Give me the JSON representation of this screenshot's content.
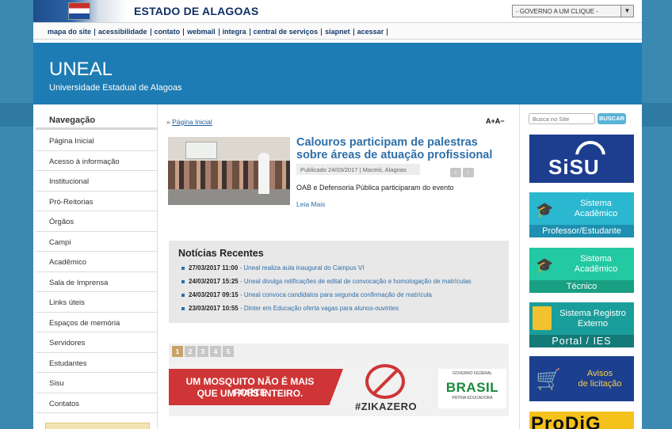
{
  "gov": {
    "title": "ESTADO DE ALAGOAS",
    "dropdown_selected": "- GOVERNO A UM CLIQUE -"
  },
  "toplinks": [
    "mapa do site",
    "acessibilidade",
    "contato",
    "webmail",
    "integra",
    "central de serviços",
    "siapnet",
    "acessar"
  ],
  "header": {
    "name": "UNEAL",
    "subtitle": "Universidade Estadual de Alagoas"
  },
  "nav": {
    "title": "Navegação",
    "items": [
      "Página Inicial",
      "Acesso à informação",
      "Institucional",
      "Pró-Reitorias",
      "Órgãos",
      "Campi",
      "Acadêmico",
      "Sala de Imprensa",
      "Links úteis",
      "Espaços de memória",
      "Servidores",
      "Estudantes",
      "Sisu",
      "Contatos"
    ]
  },
  "breadcrumb": {
    "prefix": "»",
    "current": "Página Inicial"
  },
  "font_size_control": "A+A−",
  "featured": {
    "headline": "Calouros participam de palestras sobre áreas de atuação profissional",
    "meta": "Publicado 24/03/2017 | Maceió, Alagoas",
    "summary": "OAB e Defensoria Pública participaram do evento",
    "more": "Leia Mais",
    "prev": "‹",
    "next": "›"
  },
  "recent": {
    "title": "Notícias Recentes",
    "items": [
      {
        "date": "27/03/2017 11:00",
        "text": "Uneal realiza aula inaugural do Campus VI"
      },
      {
        "date": "24/03/2017 15:25",
        "text": "Uneal divulga retificações de edital de convocação e homologação de matrículas"
      },
      {
        "date": "24/03/2017 09:15",
        "text": "Uneal convoca candidatos para segunda confirmação de matrícula"
      },
      {
        "date": "23/03/2017 10:55",
        "text": "Dinter em Educação oferta vagas para alunos-ouvintes"
      }
    ]
  },
  "pager": [
    "1",
    "2",
    "3",
    "4",
    "5"
  ],
  "banner_zika": {
    "line1": "UM MOSQUITO NÃO É MAIS FORTE",
    "line2": "QUE UM PAÍS INTEIRO.",
    "hashtag": "#ZIKAZERO",
    "gov_label": "GOVERNO FEDERAL",
    "brasil": "BRASIL",
    "patria": "PÁTRIA EDUCADORA"
  },
  "search": {
    "placeholder": "Busca no Site",
    "button": "BUSCAR"
  },
  "tiles": {
    "sisu": "SiSU",
    "acad_prof": {
      "l1": "Sistema",
      "l2": "Acadêmico",
      "foot": "Professor/Estudante"
    },
    "acad_tec": {
      "l1": "Sistema",
      "l2": "Acadêmico",
      "foot": "Técnico"
    },
    "registro": {
      "l1": "Sistema Registro",
      "l2": "Externo",
      "foot": "Portal / IES"
    },
    "licitacao": {
      "l1": "Avisos",
      "l2": "de licitação"
    },
    "prodig": "ProDiG"
  },
  "colors": {
    "brand_blue": "#1d7cb3",
    "link": "#2f6fa8",
    "zika_red": "#cf3536"
  }
}
